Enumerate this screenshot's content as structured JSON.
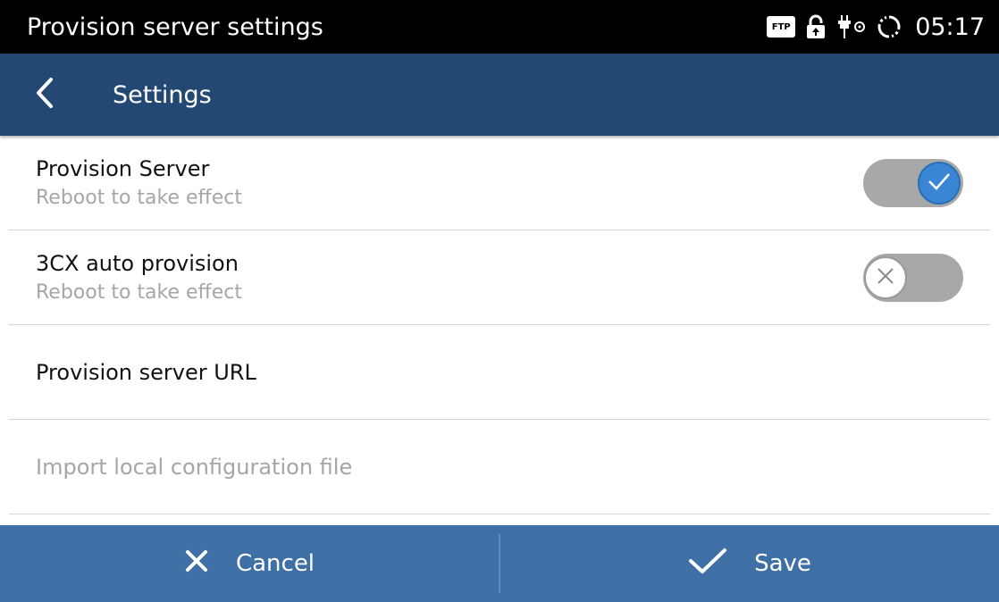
{
  "status_bar": {
    "title": "Provision server settings",
    "ftp_label": "FTP",
    "time": "05:17",
    "icons": [
      "ftp-icon",
      "lock-icon",
      "usb-icon",
      "sync-icon"
    ]
  },
  "app_bar": {
    "title": "Settings",
    "back_icon": "chevron-left-icon",
    "color": "#234873"
  },
  "settings": [
    {
      "label": "Provision Server",
      "sub": "Reboot to take effect",
      "toggle": "on"
    },
    {
      "label": "3CX auto provision",
      "sub": "Reboot to take effect",
      "toggle": "off"
    },
    {
      "label": "Provision server URL"
    },
    {
      "label": "Import local configuration file",
      "disabled": true
    }
  ],
  "bottom_bar": {
    "cancel_label": "Cancel",
    "save_label": "Save",
    "color": "#3e6fa5"
  }
}
